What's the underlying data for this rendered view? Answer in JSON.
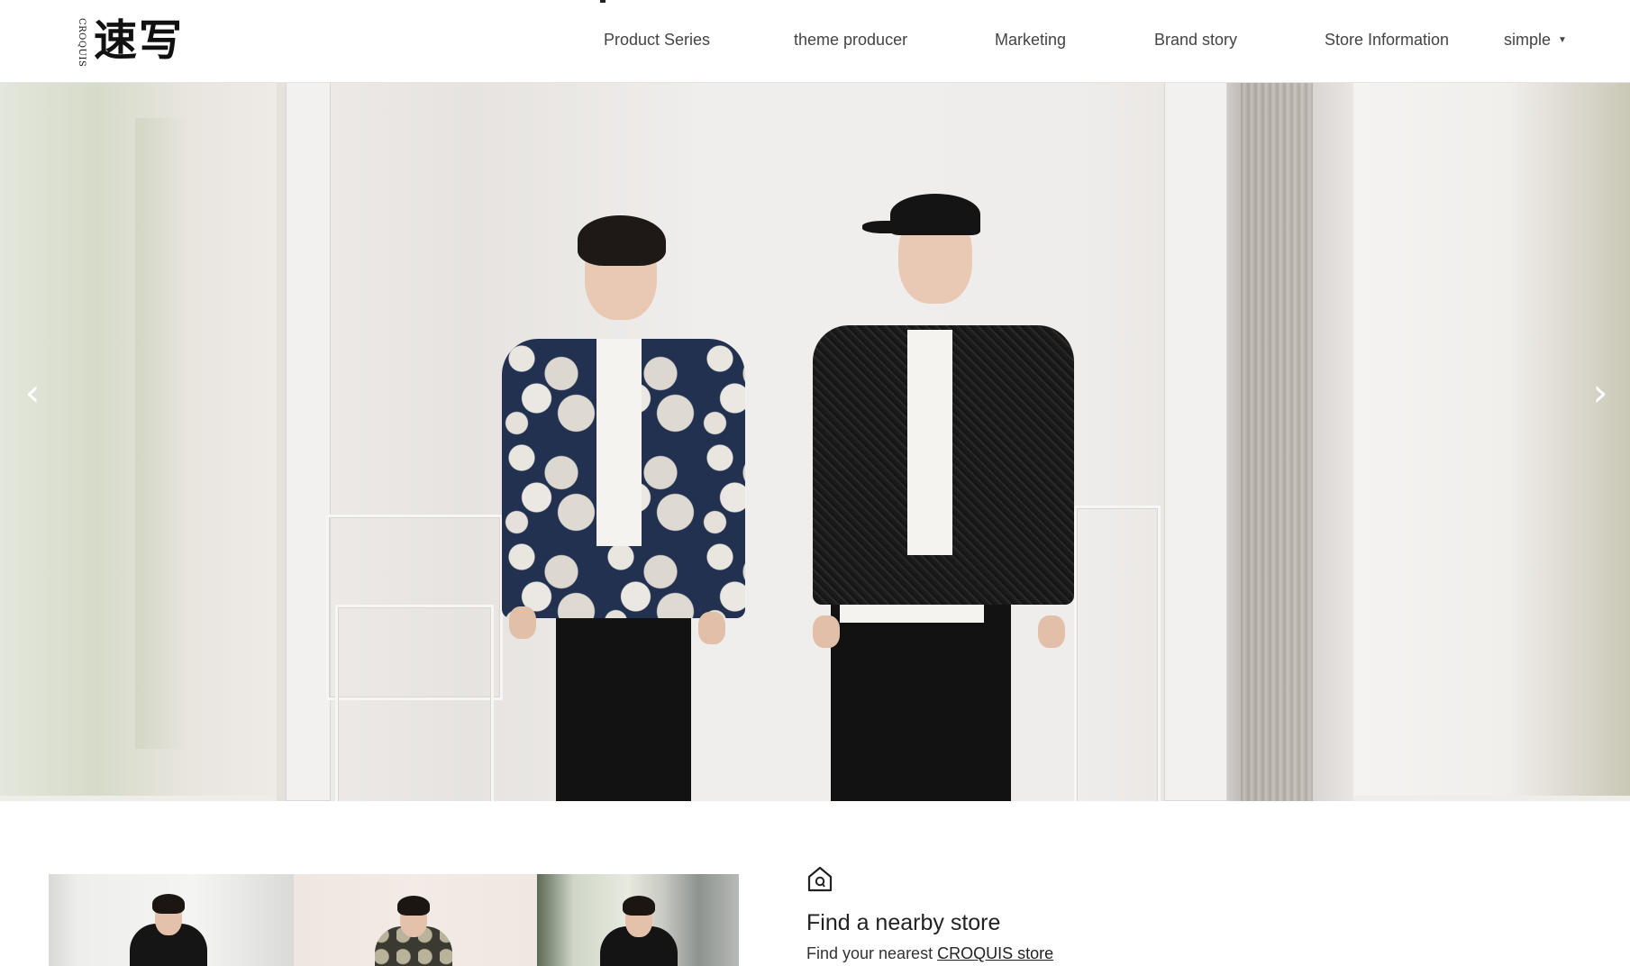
{
  "header": {
    "logo": {
      "small_text": "CROQUIS",
      "chinese_text": "速写"
    },
    "nav": [
      {
        "label": "Product Series"
      },
      {
        "label": "theme producer"
      },
      {
        "label": "Marketing"
      },
      {
        "label": "Brand story"
      },
      {
        "label": "Store Information"
      }
    ],
    "language": {
      "label": "simple",
      "icon": "caret-down-icon"
    }
  },
  "hero": {
    "prev_icon": "chevron-left-icon",
    "next_icon": "chevron-right-icon",
    "prev_glyph": "‹",
    "next_glyph": "›"
  },
  "store": {
    "icon": "house-icon",
    "title": "Find a nearby store",
    "subtitle_prefix": "Find your nearest",
    "link_text": "CROQUIS store"
  },
  "colors": {
    "header_bg": "#ffffff",
    "nav_text": "#444444",
    "title_text": "#222222"
  }
}
